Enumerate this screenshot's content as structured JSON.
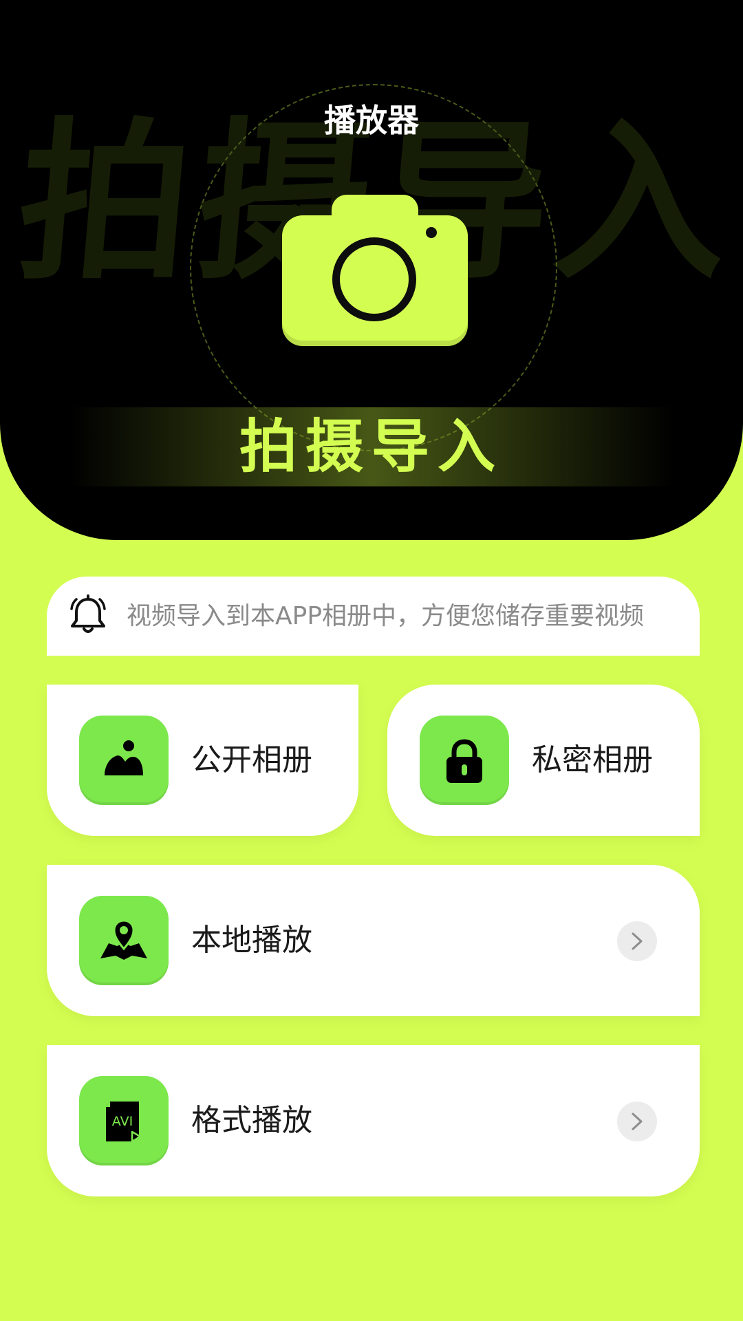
{
  "header": {
    "app_title": "播放器",
    "watermark_text": "拍摄导入",
    "banner_label": "拍摄导入",
    "camera_icon": "camera-icon"
  },
  "notice": {
    "icon": "bell-icon",
    "text": "视频导入到本APP相册中，方便您储存重要视频"
  },
  "cards": [
    {
      "label": "公开相册",
      "icon": "landscape-image-icon"
    },
    {
      "label": "私密相册",
      "icon": "padlock-icon"
    },
    {
      "label": "本地播放",
      "icon": "map-location-pin-icon"
    },
    {
      "label": "格式播放",
      "icon": "avi-file-icon",
      "icon_text": "AVI"
    }
  ],
  "colors": {
    "accent_lime": "#d4fd52",
    "icon_green": "#7de84c",
    "header_bg": "#000000",
    "card_bg": "#ffffff",
    "notice_text": "#8a8a8a"
  }
}
